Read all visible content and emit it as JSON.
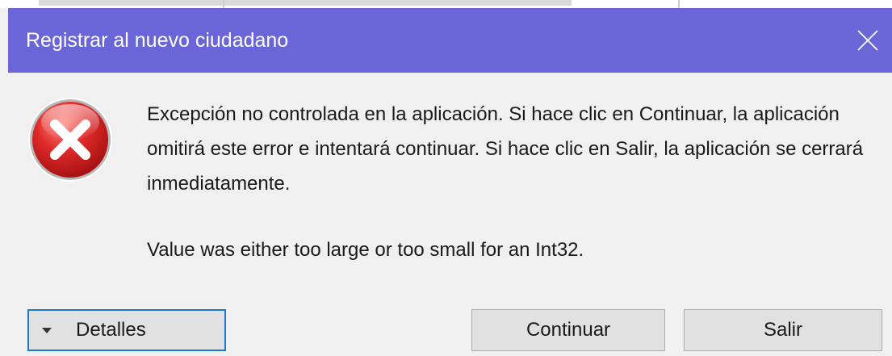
{
  "dialog": {
    "title": "Registrar al nuevo ciudadano",
    "close_icon": "close-icon",
    "error_icon": "error-icon",
    "message": "Excepción no controlada en la aplicación. Si hace clic en Continuar, la aplicación omitirá este error e intentará continuar. Si hace clic en Salir, la aplicación se cerrará inmediatamente.",
    "detail": "Value was either too large or too small for an Int32.",
    "buttons": {
      "details": "Detalles",
      "continue": "Continuar",
      "exit": "Salir"
    },
    "colors": {
      "titlebar": "#6b66d8",
      "error_red": "#c81e1e",
      "focus_border": "#1f75d0"
    }
  }
}
